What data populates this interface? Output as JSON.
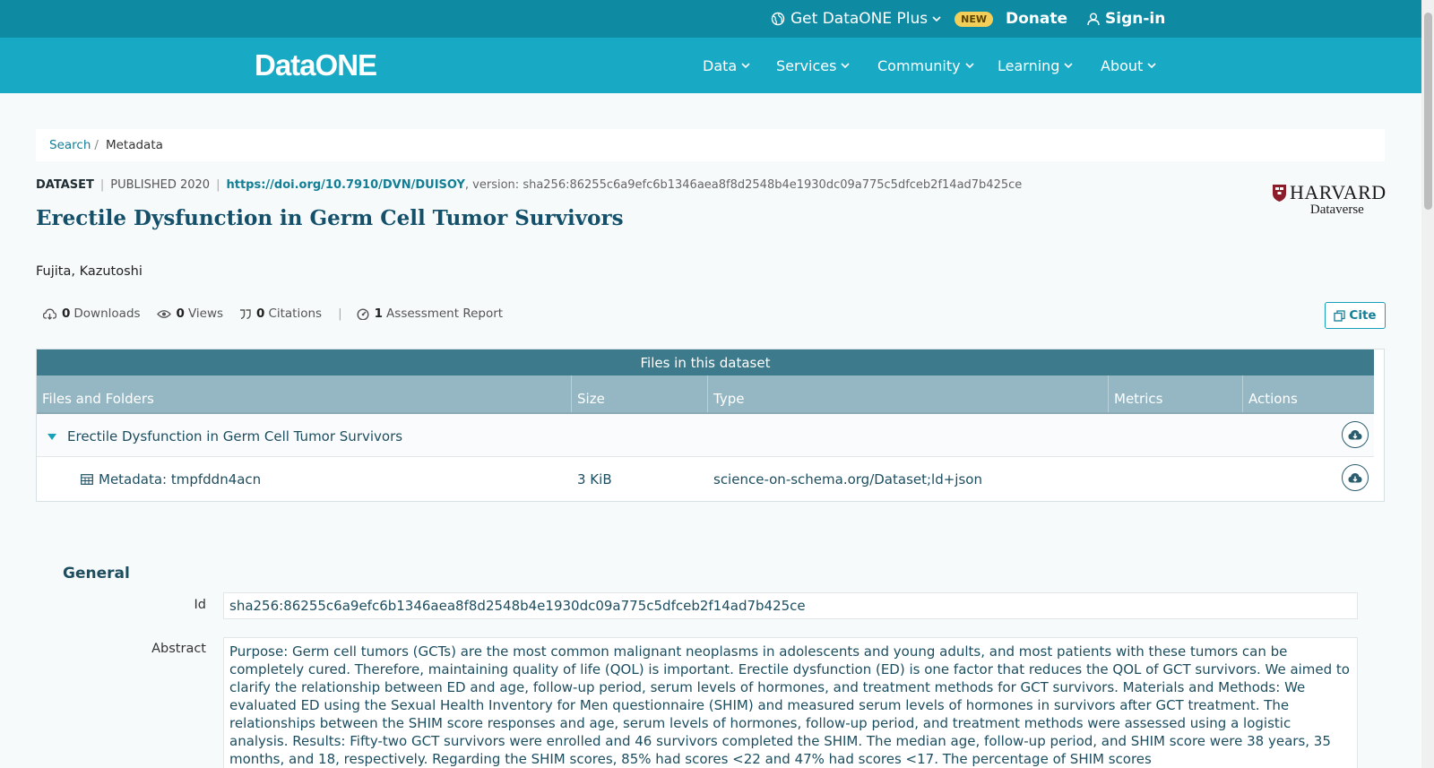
{
  "topbar": {
    "plus_label": "Get DataONE Plus",
    "new_badge": "NEW",
    "donate": "Donate",
    "signin": "Sign-in"
  },
  "nav": {
    "logo": "DataONE",
    "items": [
      {
        "label": "Data"
      },
      {
        "label": "Services"
      },
      {
        "label": "Community"
      },
      {
        "label": "Learning"
      },
      {
        "label": "About"
      }
    ]
  },
  "breadcrumb": {
    "search": "Search",
    "sep": "/",
    "current": "Metadata"
  },
  "meta": {
    "type": "DATASET",
    "published": "PUBLISHED 2020",
    "doi": "https://doi.org/10.7910/DVN/DUISOY",
    "version": ", version: sha256:86255c6a9efc6b1346aea8f8d2548b4e1930dc09a775c5dfceb2f14ad7b425ce"
  },
  "dataset": {
    "title": "Erectile Dysfunction in Germ Cell Tumor Survivors",
    "author": "Fujita, Kazutoshi"
  },
  "repository": {
    "name": "HARVARD",
    "sub": "Dataverse"
  },
  "stats": {
    "downloads_count": "0",
    "downloads_label": "Downloads",
    "views_count": "0",
    "views_label": "Views",
    "citations_count": "0",
    "citations_label": "Citations",
    "assessment_count": "1",
    "assessment_label": "Assessment Report"
  },
  "cite_label": "Cite",
  "files": {
    "header": "Files in this dataset",
    "columns": [
      "Files and Folders",
      "Size",
      "Type",
      "Metrics",
      "Actions"
    ],
    "folder_name": "Erectile Dysfunction in Germ Cell Tumor Survivors",
    "file_name": "Metadata: tmpfddn4acn",
    "file_size": "3 KiB",
    "file_type": "science-on-schema.org/Dataset;ld+json"
  },
  "general": {
    "heading": "General",
    "id_label": "Id",
    "id_value": "sha256:86255c6a9efc6b1346aea8f8d2548b4e1930dc09a775c5dfceb2f14ad7b425ce",
    "abstract_label": "Abstract",
    "abstract_value": "Purpose: Germ cell tumors (GCTs) are the most common malignant neoplasms in adolescents and young adults, and most patients with these tumors can be completely cured. Therefore, maintaining quality of life (QOL) is important. Erectile dysfunction (ED) is one factor that reduces the QOL of GCT survivors. We aimed to clarify the relationship between ED and age, follow-up period, serum levels of hormones, and treatment methods for GCT survivors. Materials and Methods: We evaluated ED using the Sexual Health Inventory for Men questionnaire (SHIM) and measured serum levels of hormones in survivors after GCT treatment. The relationships between the SHIM score responses and age, serum levels of hormones, follow-up period, and treatment methods were assessed using a logistic analysis. Results: Fifty-two GCT survivors were enrolled and 46 survivors completed the SHIM. The median age, follow-up period, and SHIM score were 38 years, 35 months, and 18, respectively. Regarding the SHIM scores, 85% had scores <22 and 47% had scores <17. The percentage of SHIM scores"
  },
  "colors": {
    "topbar": "#0f8aa3",
    "navbar": "#18a9c4",
    "accent": "#127f96",
    "title": "#14506a",
    "table_head": "#3d7b8c",
    "table_cols": "#95b7c3",
    "badge": "#f3cf5a"
  },
  "icons": [
    "globe-icon",
    "chevron-down-icon",
    "user-icon",
    "cloud-download-icon",
    "eye-icon",
    "quote-icon",
    "gauge-icon",
    "copy-icon",
    "caret-down-icon",
    "table-icon",
    "harvard-shield-icon"
  ]
}
